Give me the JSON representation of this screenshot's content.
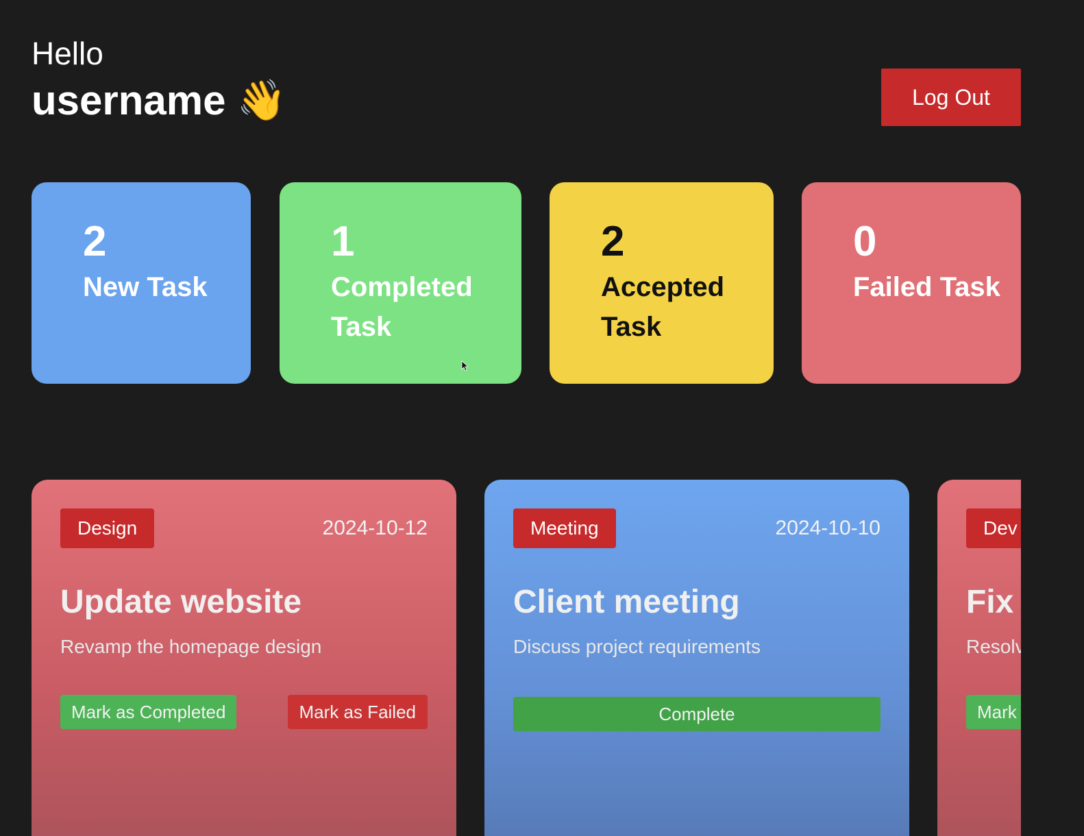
{
  "header": {
    "greeting": "Hello",
    "username": "username",
    "wave_emoji": "👋",
    "logout_label": "Log Out"
  },
  "stats": [
    {
      "count": "2",
      "label": "New Task",
      "color": "#6aa3ee"
    },
    {
      "count": "1",
      "label": "Completed Task",
      "color": "#7de283"
    },
    {
      "count": "2",
      "label": "Accepted Task",
      "color": "#f3d246"
    },
    {
      "count": "0",
      "label": "Failed Task",
      "color": "#e07076"
    }
  ],
  "tasks": [
    {
      "category": "Design",
      "date": "2024-10-12",
      "title": "Update website",
      "description": "Revamp the homepage design",
      "primary_action": "Mark as Completed",
      "secondary_action": "Mark as Failed",
      "color": "#e2727a"
    },
    {
      "category": "Meeting",
      "date": "2024-10-10",
      "title": "Client meeting",
      "description": "Discuss project requirements",
      "primary_action": "Complete",
      "color": "#6ea6ef"
    },
    {
      "category": "Dev",
      "title": "Fix",
      "description": "Resolv",
      "primary_action": "Mark",
      "color": "#e2727a"
    }
  ],
  "colors": {
    "background": "#1c1c1c",
    "danger": "#c62a2a",
    "success": "#4db356"
  }
}
